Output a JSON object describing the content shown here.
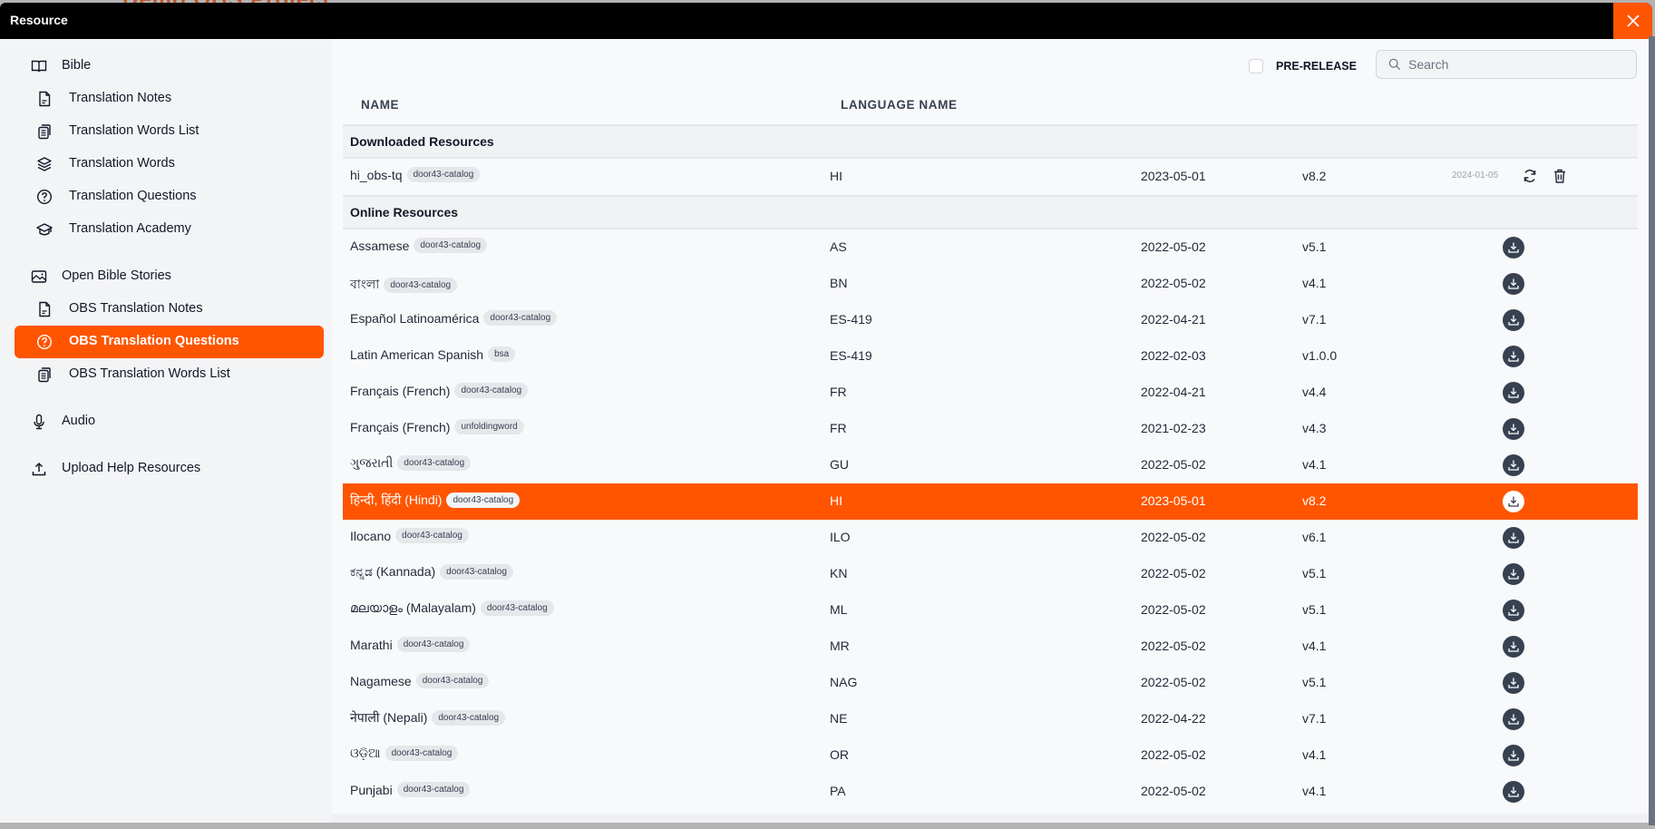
{
  "backdrop": {
    "title": "Demo OBS Project"
  },
  "modal": {
    "title": "Resource",
    "close_icon": "close-icon"
  },
  "sidebar": {
    "items": [
      {
        "label": "Bible",
        "icon": "book-open-icon",
        "level": 0,
        "active": false
      },
      {
        "label": "Translation Notes",
        "icon": "document-icon",
        "level": 1,
        "active": false
      },
      {
        "label": "Translation Words List",
        "icon": "clipboard-list-icon",
        "level": 1,
        "active": false
      },
      {
        "label": "Translation Words",
        "icon": "layers-icon",
        "level": 1,
        "active": false
      },
      {
        "label": "Translation Questions",
        "icon": "question-circle-icon",
        "level": 1,
        "active": false
      },
      {
        "label": "Translation Academy",
        "icon": "academic-cap-icon",
        "level": 1,
        "active": false
      },
      {
        "label": "Open Bible Stories",
        "icon": "image-icon",
        "level": 0,
        "active": false
      },
      {
        "label": "OBS Translation Notes",
        "icon": "document-icon",
        "level": 1,
        "active": false
      },
      {
        "label": "OBS Translation Questions",
        "icon": "question-circle-icon",
        "level": 1,
        "active": true
      },
      {
        "label": "OBS Translation Words List",
        "icon": "clipboard-list-icon",
        "level": 1,
        "active": false
      },
      {
        "label": "Audio",
        "icon": "microphone-icon",
        "level": 0,
        "active": false
      },
      {
        "label": "Upload Help Resources",
        "icon": "upload-icon",
        "level": 0,
        "active": false
      }
    ]
  },
  "toolbar": {
    "prerelease_label": "PRE-RELEASE",
    "prerelease_checked": false,
    "search_placeholder": "Search",
    "search_value": ""
  },
  "table": {
    "columns": [
      "NAME",
      "LANGUAGE NAME"
    ],
    "downloaded_section": "Downloaded Resources",
    "downloaded": [
      {
        "name": "hi_obs-tq",
        "badge": "door43-catalog",
        "lang": "HI",
        "date": "2023-05-01",
        "version": "v8.2",
        "downloaded_date": "2024-01-05"
      }
    ],
    "online_section": "Online Resources",
    "online": [
      {
        "name": "Assamese",
        "badge": "door43-catalog",
        "lang": "AS",
        "date": "2022-05-02",
        "version": "v5.1",
        "selected": false
      },
      {
        "name": "বাংলা",
        "badge": "door43-catalog",
        "lang": "BN",
        "date": "2022-05-02",
        "version": "v4.1",
        "selected": false
      },
      {
        "name": "Español Latinoamérica",
        "badge": "door43-catalog",
        "lang": "ES-419",
        "date": "2022-04-21",
        "version": "v7.1",
        "selected": false
      },
      {
        "name": "Latin American Spanish",
        "badge": "bsa",
        "lang": "ES-419",
        "date": "2022-02-03",
        "version": "v1.0.0",
        "selected": false
      },
      {
        "name": "Français (French)",
        "badge": "door43-catalog",
        "lang": "FR",
        "date": "2022-04-21",
        "version": "v4.4",
        "selected": false
      },
      {
        "name": "Français (French)",
        "badge": "unfoldingword",
        "lang": "FR",
        "date": "2021-02-23",
        "version": "v4.3",
        "selected": false
      },
      {
        "name": "ગુજરાતી",
        "badge": "door43-catalog",
        "lang": "GU",
        "date": "2022-05-02",
        "version": "v4.1",
        "selected": false
      },
      {
        "name": "हिन्दी, हिंदी (Hindi)",
        "badge": "door43-catalog",
        "lang": "HI",
        "date": "2023-05-01",
        "version": "v8.2",
        "selected": true
      },
      {
        "name": "Ilocano",
        "badge": "door43-catalog",
        "lang": "ILO",
        "date": "2022-05-02",
        "version": "v6.1",
        "selected": false
      },
      {
        "name": "ಕನ್ನಡ (Kannada)",
        "badge": "door43-catalog",
        "lang": "KN",
        "date": "2022-05-02",
        "version": "v5.1",
        "selected": false
      },
      {
        "name": "മലയാളം (Malayalam)",
        "badge": "door43-catalog",
        "lang": "ML",
        "date": "2022-05-02",
        "version": "v5.1",
        "selected": false
      },
      {
        "name": "Marathi",
        "badge": "door43-catalog",
        "lang": "MR",
        "date": "2022-05-02",
        "version": "v4.1",
        "selected": false
      },
      {
        "name": "Nagamese",
        "badge": "door43-catalog",
        "lang": "NAG",
        "date": "2022-05-02",
        "version": "v5.1",
        "selected": false
      },
      {
        "name": "नेपाली (Nepali)",
        "badge": "door43-catalog",
        "lang": "NE",
        "date": "2022-04-22",
        "version": "v7.1",
        "selected": false
      },
      {
        "name": "ଓଡ଼ିଆ",
        "badge": "door43-catalog",
        "lang": "OR",
        "date": "2022-05-02",
        "version": "v4.1",
        "selected": false
      },
      {
        "name": "Punjabi",
        "badge": "door43-catalog",
        "lang": "PA",
        "date": "2022-05-02",
        "version": "v4.1",
        "selected": false
      }
    ]
  },
  "colors": {
    "accent": "#ff5500",
    "titlebar": "#000000",
    "download_button": "#374151"
  }
}
